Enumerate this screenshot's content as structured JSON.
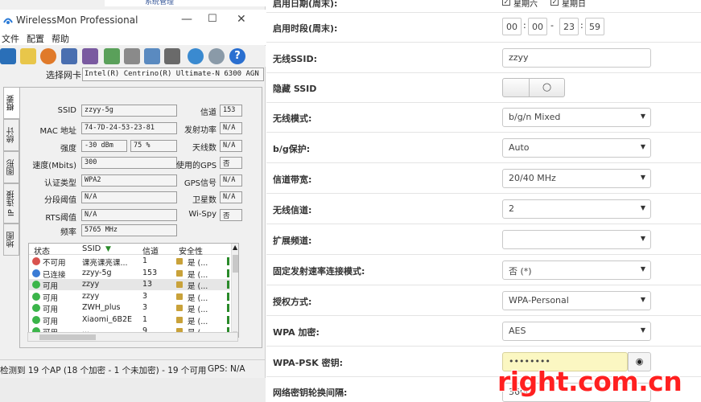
{
  "top_partial": "系统管理",
  "wm": {
    "title": "WirelessMon Professional",
    "menu": [
      "文件",
      "配置",
      "帮助"
    ],
    "adapter_label": "选择网卡",
    "adapter_value": "Intel(R) Centrino(R) Ultimate-N 6300 AGN",
    "tabs": [
      "概要",
      "统计",
      "图形",
      "IP 连接",
      "地图"
    ],
    "fields": {
      "ssid_label": "SSID",
      "ssid_value": "zzyy-5g",
      "mac_label": "MAC 地址",
      "mac_value": "74-7D-24-53-23-81",
      "strength_label": "强度",
      "strength_dbm": "-30 dBm",
      "strength_pct": "75 %",
      "speed_label": "速度(Mbits)",
      "speed_value": "300",
      "auth_label": "认证类型",
      "auth_value": "WPA2",
      "frag_label": "分段阈值",
      "frag_value": "N/A",
      "rts_label": "RTS阈值",
      "rts_value": "N/A",
      "freq_label": "频率",
      "freq_value": "5765 MHz",
      "channel_label": "信道",
      "channel_value": "153",
      "txpower_label": "发射功率",
      "txpower_value": "N/A",
      "antenna_label": "天线数",
      "antenna_value": "N/A",
      "gps_used_label": "使用的GPS",
      "gps_used_value": "否",
      "gps_signal_label": "GPS信号",
      "gps_signal_value": "N/A",
      "satellites_label": "卫星数",
      "satellites_value": "N/A",
      "wispy_label": "Wi-Spy",
      "wispy_value": "否"
    },
    "list": {
      "headers": [
        "状态",
        "SSID",
        "信道",
        "安全性"
      ],
      "rows": [
        {
          "status": "不可用",
          "ssid": "课亮课亮课...",
          "channel": "1",
          "security": "是 (...",
          "color": "#d9534f"
        },
        {
          "status": "已连接",
          "ssid": "zzyy-5g",
          "channel": "153",
          "security": "是 (...",
          "color": "#3a7bd5"
        },
        {
          "status": "可用",
          "ssid": "zzyy",
          "channel": "13",
          "security": "是 (...",
          "color": "#3bb54a"
        },
        {
          "status": "可用",
          "ssid": "zzyy",
          "channel": "3",
          "security": "是 (...",
          "color": "#3bb54a"
        },
        {
          "status": "可用",
          "ssid": "ZWH_plus",
          "channel": "3",
          "security": "是 (...",
          "color": "#3bb54a"
        },
        {
          "status": "可用",
          "ssid": "Xiaomi_6B2E",
          "channel": "1",
          "security": "是 (...",
          "color": "#3bb54a"
        },
        {
          "status": "可用",
          "ssid": "...",
          "channel": "9",
          "security": "是 (...",
          "color": "#3bb54a"
        }
      ]
    },
    "status_text": "检测到 19 个AP (18 个加密 - 1 个未加密) - 19 个可用",
    "gps_status": "GPS: N/A"
  },
  "router": {
    "row0_label": "启用日期(周末):",
    "sat_label": "星期六",
    "sun_label": "星期日",
    "time_label": "启用时段(周末):",
    "time": {
      "h1": "00",
      "m1": "00",
      "sep": "-",
      "h2": "23",
      "m2": "59"
    },
    "ssid_label": "无线SSID:",
    "ssid_value": "zzyy",
    "hide_label": "隐藏 SSID",
    "mode_label": "无线模式:",
    "mode_value": "b/g/n Mixed",
    "bg_label": "b/g保护:",
    "bg_value": "Auto",
    "bw_label": "信道带宽:",
    "bw_value": "20/40 MHz",
    "channel_label": "无线信道:",
    "channel_value": "2",
    "ext_label": "扩展频道:",
    "ext_value": "",
    "rate_label": "固定发射速率连接模式:",
    "rate_value": "否 (*)",
    "auth_label": "授权方式:",
    "auth_value": "WPA-Personal",
    "wpa_label": "WPA 加密:",
    "wpa_value": "AES",
    "psk_label": "WPA-PSK 密钥:",
    "psk_value": "••••••••",
    "rekey_label": "网络密钥轮换间隔:",
    "rekey_value": "3600"
  },
  "watermark": "right.com.cn"
}
